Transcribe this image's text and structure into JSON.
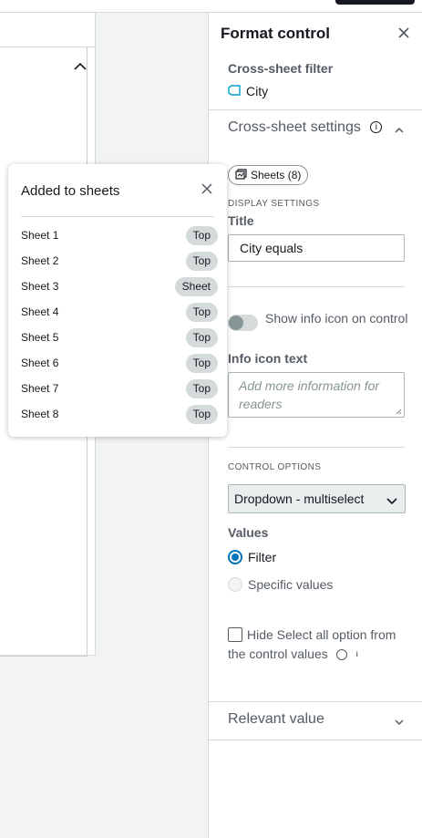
{
  "canvas": {
    "expand_icon": "chevron-up-icon"
  },
  "panel": {
    "title": "Format control",
    "close_icon": "close-icon",
    "cross_sheet_filter": {
      "label": "Cross-sheet filter",
      "field_icon": "dimension-tag-icon",
      "field": "City"
    },
    "cross_sheet_settings": {
      "title": "Cross-sheet settings",
      "sheets_button": "Sheets (8)",
      "display_settings_label": "DISPLAY SETTINGS",
      "title_label": "Title",
      "title_value": "City equals",
      "toggle_label": "Show info icon on control",
      "toggle_on": false,
      "info_icon_text_label": "Info icon text",
      "info_icon_text_placeholder": "Add more information for readers",
      "control_options_label": "CONTROL OPTIONS",
      "control_type": "Dropdown - multiselect",
      "values_label": "Values",
      "value_options": [
        {
          "label": "Filter",
          "selected": true
        },
        {
          "label": "Specific values",
          "selected": false
        }
      ],
      "hide_select_all_label": "Hide Select all option from the control values",
      "hide_select_all_checked": false
    },
    "relevant_value": {
      "title": "Relevant value"
    }
  },
  "popover": {
    "title": "Added to sheets",
    "close_icon": "close-icon",
    "sheets": [
      {
        "name": "Sheet 1",
        "position": "Top"
      },
      {
        "name": "Sheet 2",
        "position": "Top"
      },
      {
        "name": "Sheet 3",
        "position": "Sheet"
      },
      {
        "name": "Sheet 4",
        "position": "Top"
      },
      {
        "name": "Sheet 5",
        "position": "Top"
      },
      {
        "name": "Sheet 6",
        "position": "Top"
      },
      {
        "name": "Sheet 7",
        "position": "Top"
      },
      {
        "name": "Sheet 8",
        "position": "Top"
      }
    ]
  },
  "colors": {
    "accent": "#0073bb",
    "tag": "#00a1c9",
    "text_primary": "#16191f",
    "text_secondary": "#545b64"
  }
}
